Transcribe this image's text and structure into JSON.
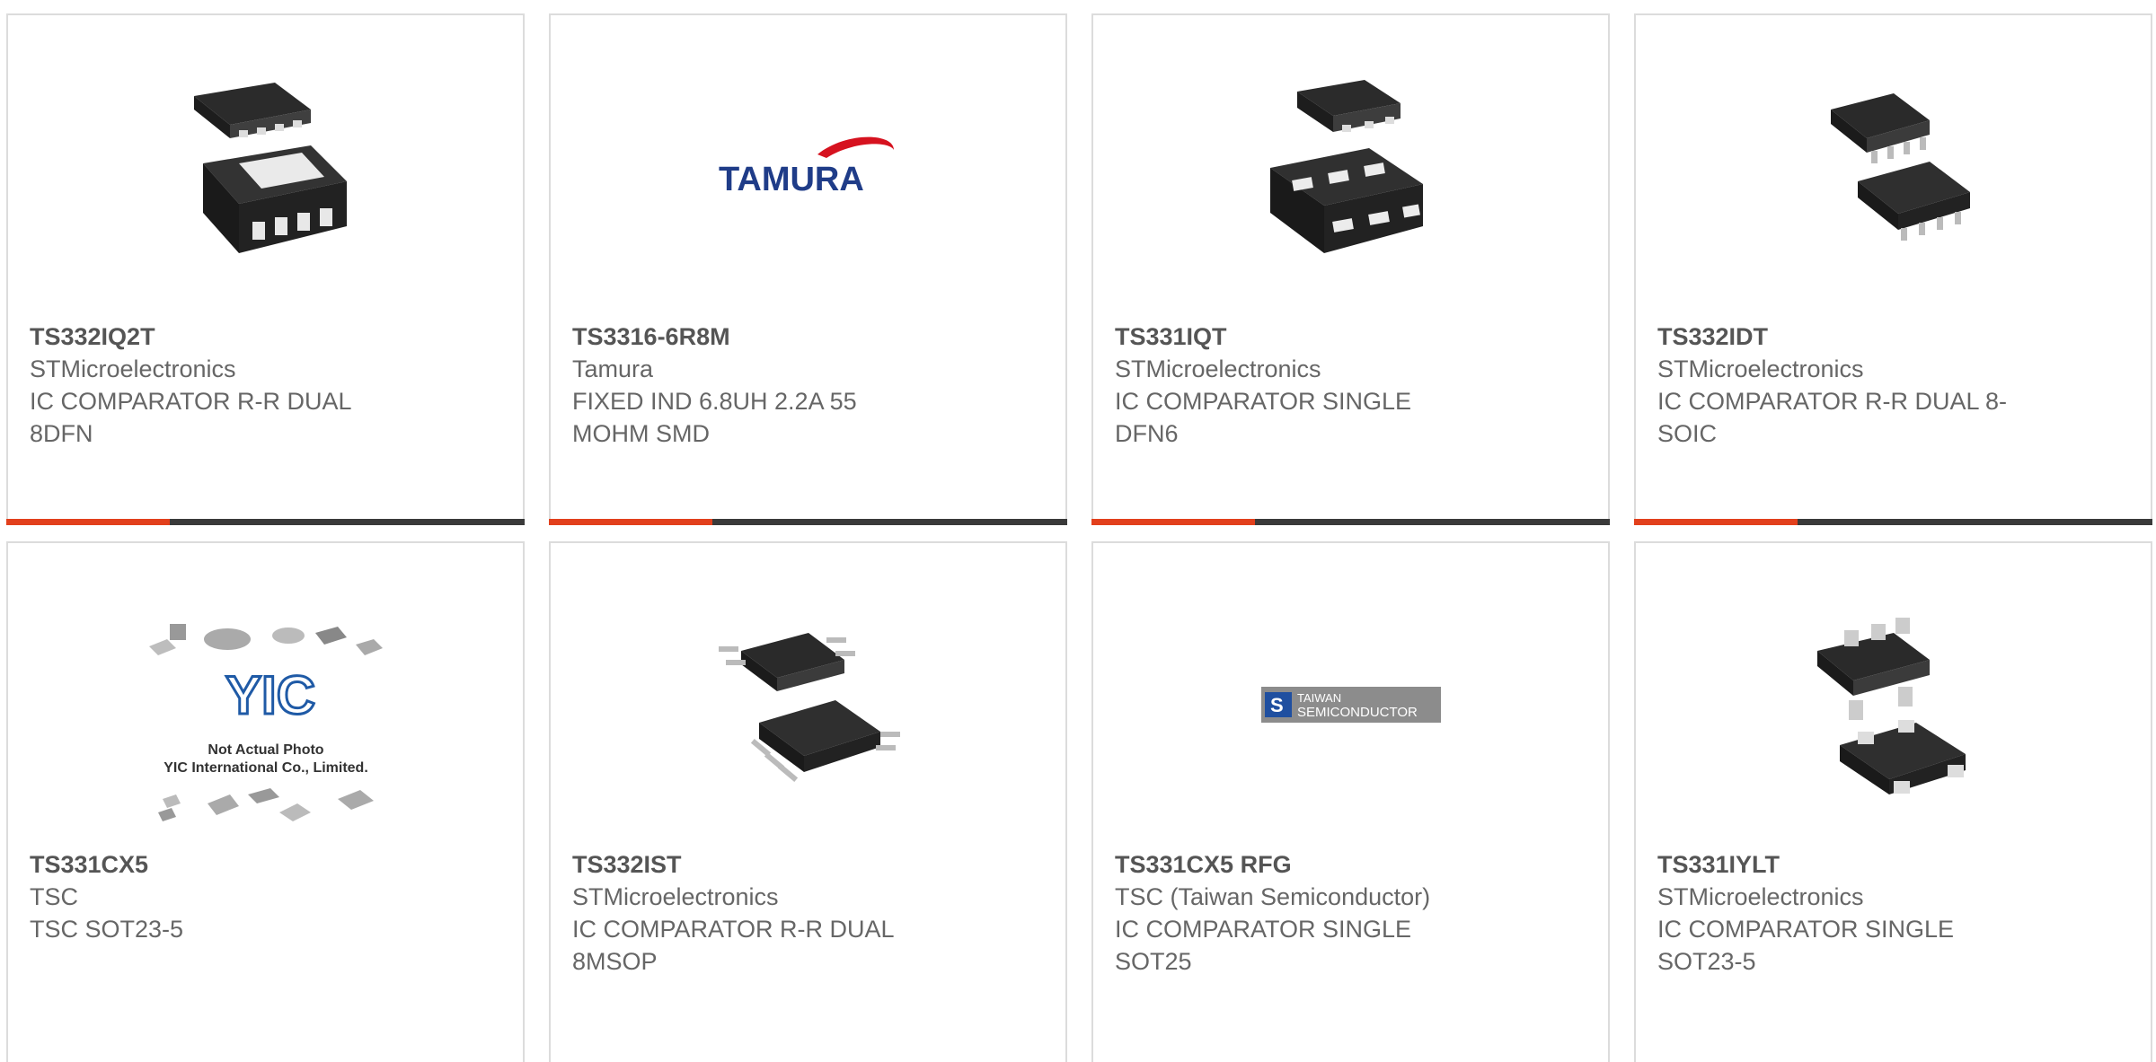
{
  "products": [
    {
      "part": "TS332IQ2T",
      "manufacturer": "STMicroelectronics",
      "desc_line1": "IC COMPARATOR R-R DUAL",
      "desc_line2": "8DFN",
      "image": "dfn8-package-icon"
    },
    {
      "part": "TS3316-6R8M",
      "manufacturer": "Tamura",
      "desc_line1": "FIXED IND 6.8UH 2.2A 55",
      "desc_line2": "MOHM SMD",
      "image": "tamura-logo",
      "logo_text": "TAMURA"
    },
    {
      "part": "TS331IQT",
      "manufacturer": "STMicroelectronics",
      "desc_line1": "IC COMPARATOR SINGLE",
      "desc_line2": "DFN6",
      "image": "dfn6-package-icon"
    },
    {
      "part": "TS332IDT",
      "manufacturer": "STMicroelectronics",
      "desc_line1": "IC COMPARATOR R-R DUAL 8-",
      "desc_line2": "SOIC",
      "image": "soic8-package-icon"
    },
    {
      "part": "TS331CX5",
      "manufacturer": "TSC",
      "desc_line1": "TSC SOT23-5",
      "desc_line2": "",
      "image": "not-actual-photo-placeholder",
      "placeholder_line1": "Not Actual Photo",
      "placeholder_line2": "YIC International Co., Limited.",
      "placeholder_logo": "YIC"
    },
    {
      "part": "TS332IST",
      "manufacturer": "STMicroelectronics",
      "desc_line1": "IC COMPARATOR R-R DUAL",
      "desc_line2": "8MSOP",
      "image": "msop8-package-icon"
    },
    {
      "part": "TS331CX5 RFG",
      "manufacturer": "TSC (Taiwan Semiconductor)",
      "desc_line1": "IC COMPARATOR SINGLE",
      "desc_line2": "SOT25",
      "image": "taiwan-semiconductor-logo",
      "logo_line1": "TAIWAN",
      "logo_line2": "SEMICONDUCTOR"
    },
    {
      "part": "TS331IYLT",
      "manufacturer": "STMicroelectronics",
      "desc_line1": "IC COMPARATOR SINGLE",
      "desc_line2": "SOT23-5",
      "image": "sot23-5-package-icon"
    }
  ],
  "colors": {
    "accent": "#e2401c",
    "bar": "#3a3a3a",
    "border": "#dcdcdc",
    "text": "#666666"
  }
}
